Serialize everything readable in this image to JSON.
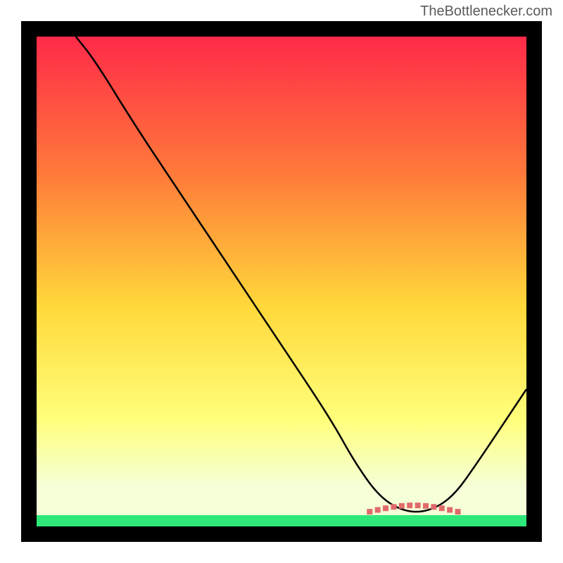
{
  "watermark": "TheBottlenecker.com",
  "chart_data": {
    "type": "line",
    "title": "",
    "xlabel": "",
    "ylabel": "",
    "xlim": [
      0,
      100
    ],
    "ylim": [
      0,
      100
    ],
    "background_gradient": {
      "top": "#ff2a49",
      "mid1": "#ff7a3a",
      "mid2": "#ffd83a",
      "mid3": "#ffff7a",
      "bottom": "#f5ffd8",
      "green_band": "#2ee87a"
    },
    "series": [
      {
        "name": "curve",
        "color": "#000000",
        "x": [
          8,
          12,
          20,
          30,
          40,
          50,
          60,
          65,
          70,
          75,
          80,
          85,
          90,
          100
        ],
        "y": [
          100,
          95,
          82,
          67,
          52,
          37,
          22,
          13,
          6,
          3,
          3,
          6,
          13,
          28
        ]
      }
    ],
    "valley_marker": {
      "color": "#e06a6a",
      "shape": "dotted-arc",
      "x_start": 68,
      "x_end": 86,
      "y": 3
    }
  }
}
